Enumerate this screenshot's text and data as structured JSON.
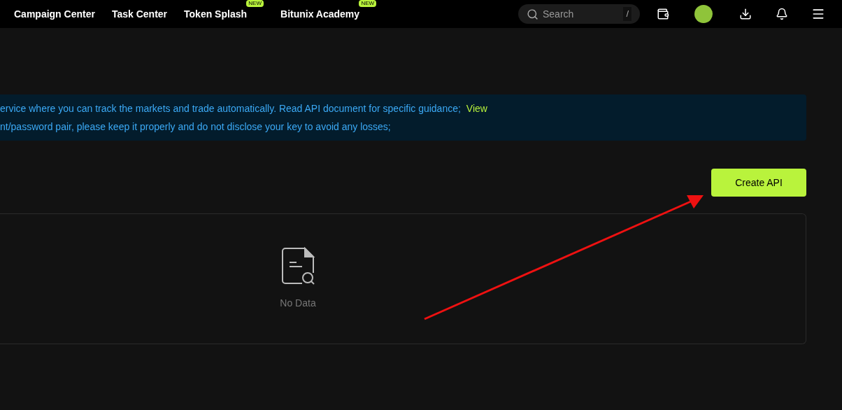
{
  "nav": {
    "items": [
      {
        "label": "Campaign Center"
      },
      {
        "label": "Task Center"
      },
      {
        "label": "Token Splash",
        "badge": "NEW"
      },
      {
        "label": "Bitunix Academy",
        "badge": "NEW"
      }
    ],
    "search": {
      "placeholder": "Search",
      "shortcut": "/"
    }
  },
  "notice": {
    "lines": [
      "ervice where you can track the markets and trade automatically. Read API document for specific guidance;",
      "nt/password pair, please keep it properly and do not disclose your key to avoid any losses;"
    ],
    "link": "View"
  },
  "create_button": "Create API",
  "empty_state": {
    "text": "No Data"
  }
}
